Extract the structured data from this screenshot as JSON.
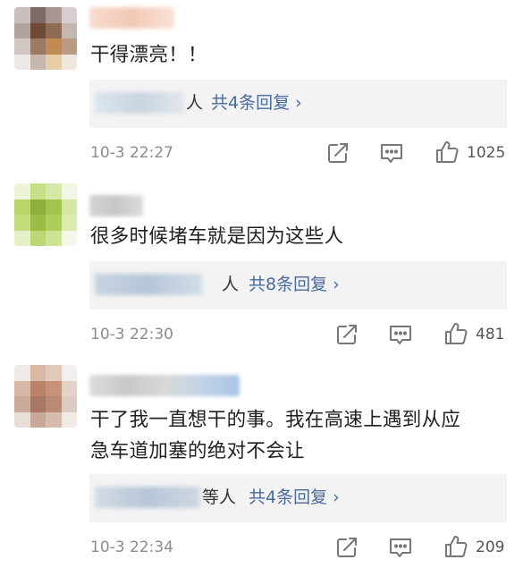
{
  "comments": [
    {
      "text_lines": [
        "干得漂亮！！"
      ],
      "reply_suffix": "人",
      "reply_label": "共4条回复 ›",
      "time": "10-3 22:27",
      "likes": "1025",
      "icons": [
        "repost-icon",
        "comment-icon",
        "thumbs-up-icon"
      ]
    },
    {
      "text_lines": [
        "很多时候堵车就是因为这些人"
      ],
      "reply_suffix": "人",
      "reply_label": "共8条回复 ›",
      "time": "10-3 22:30",
      "likes": "481",
      "icons": [
        "repost-icon",
        "comment-icon",
        "thumbs-up-icon"
      ]
    },
    {
      "text_lines": [
        "干了我一直想干的事。我在高速上遇到从应",
        "急车道加塞的绝对不会让"
      ],
      "reply_suffix": "等人",
      "reply_label": "共4条回复 ›",
      "time": "10-3 22:34",
      "likes": "209",
      "icons": [
        "repost-icon",
        "comment-icon",
        "thumbs-up-icon"
      ]
    }
  ],
  "colors": {
    "link": "#486b9b",
    "meta": "#8c8c8c",
    "reply_bg": "#f3f3f3"
  }
}
